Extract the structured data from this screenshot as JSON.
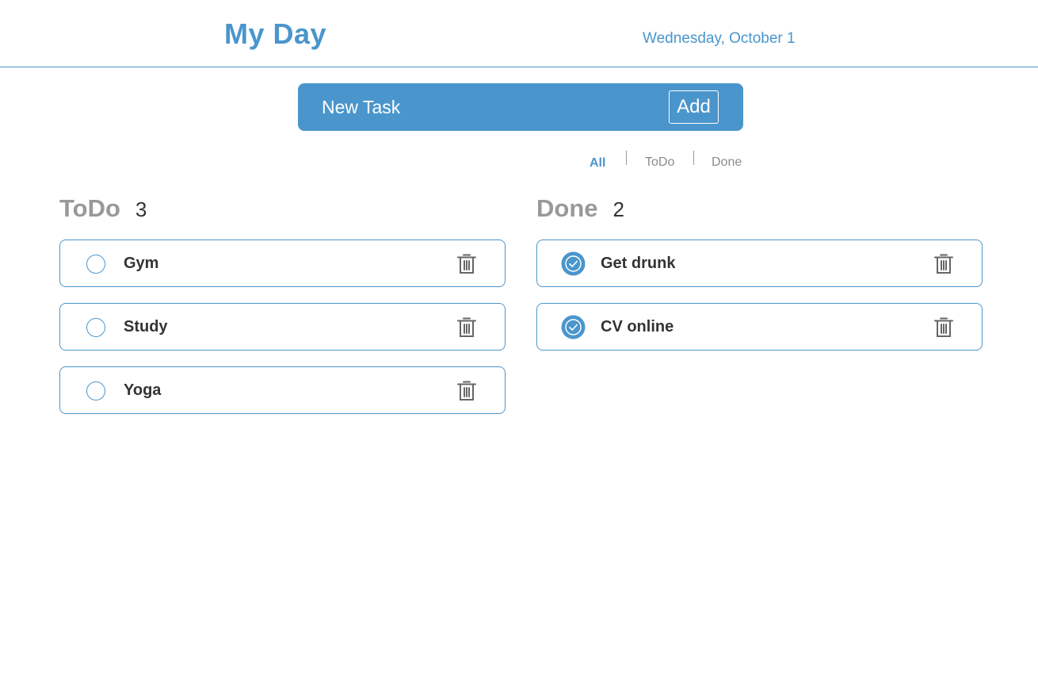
{
  "header": {
    "title": "My Day",
    "date": "Wednesday, October 1"
  },
  "new_task": {
    "placeholder": "New Task",
    "add_label": "Add"
  },
  "filters": {
    "all": "All",
    "todo": "ToDo",
    "done": "Done",
    "active": "All"
  },
  "todo_column": {
    "title": "ToDo",
    "count": "3",
    "items": [
      {
        "label": "Gym"
      },
      {
        "label": "Study"
      },
      {
        "label": "Yoga"
      }
    ]
  },
  "done_column": {
    "title": "Done",
    "count": "2",
    "items": [
      {
        "label": "Get drunk"
      },
      {
        "label": "CV online"
      }
    ]
  },
  "colors": {
    "accent": "#4a96cc",
    "muted": "#999999",
    "text": "#333333",
    "trash": "#666666"
  },
  "icons": {
    "unchecked": "circle-outline-icon",
    "checked": "check-circle-icon",
    "delete": "trash-icon"
  }
}
